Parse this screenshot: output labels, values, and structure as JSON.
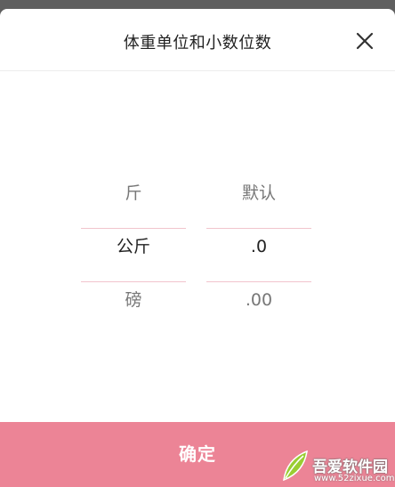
{
  "dialog": {
    "title": "体重单位和小数位数",
    "close_icon": "close-icon",
    "confirm_label": "确定"
  },
  "pickers": {
    "unit": {
      "options": [
        "斤",
        "公斤",
        "磅"
      ],
      "selected_index": 1
    },
    "decimal": {
      "options": [
        "默认",
        ".0",
        ".00"
      ],
      "selected_index": 1
    }
  },
  "watermark": {
    "site_name": "吾爱软件园",
    "url": "www.52zixue.com",
    "logo_icon": "leaf-logo-icon"
  },
  "colors": {
    "accent": "#ec8496",
    "divider": "#f1c4cd",
    "overlay": "#5f5f5f"
  }
}
